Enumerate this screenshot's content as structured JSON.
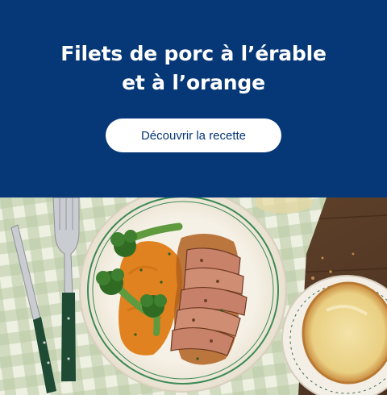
{
  "banner": {
    "title_line1": "Filets de porc à l’érable",
    "title_line2": "et à l’orange",
    "cta_label": "Découvrir la recette",
    "background_color": "#063777"
  },
  "photo": {
    "description": "dish-photo"
  }
}
